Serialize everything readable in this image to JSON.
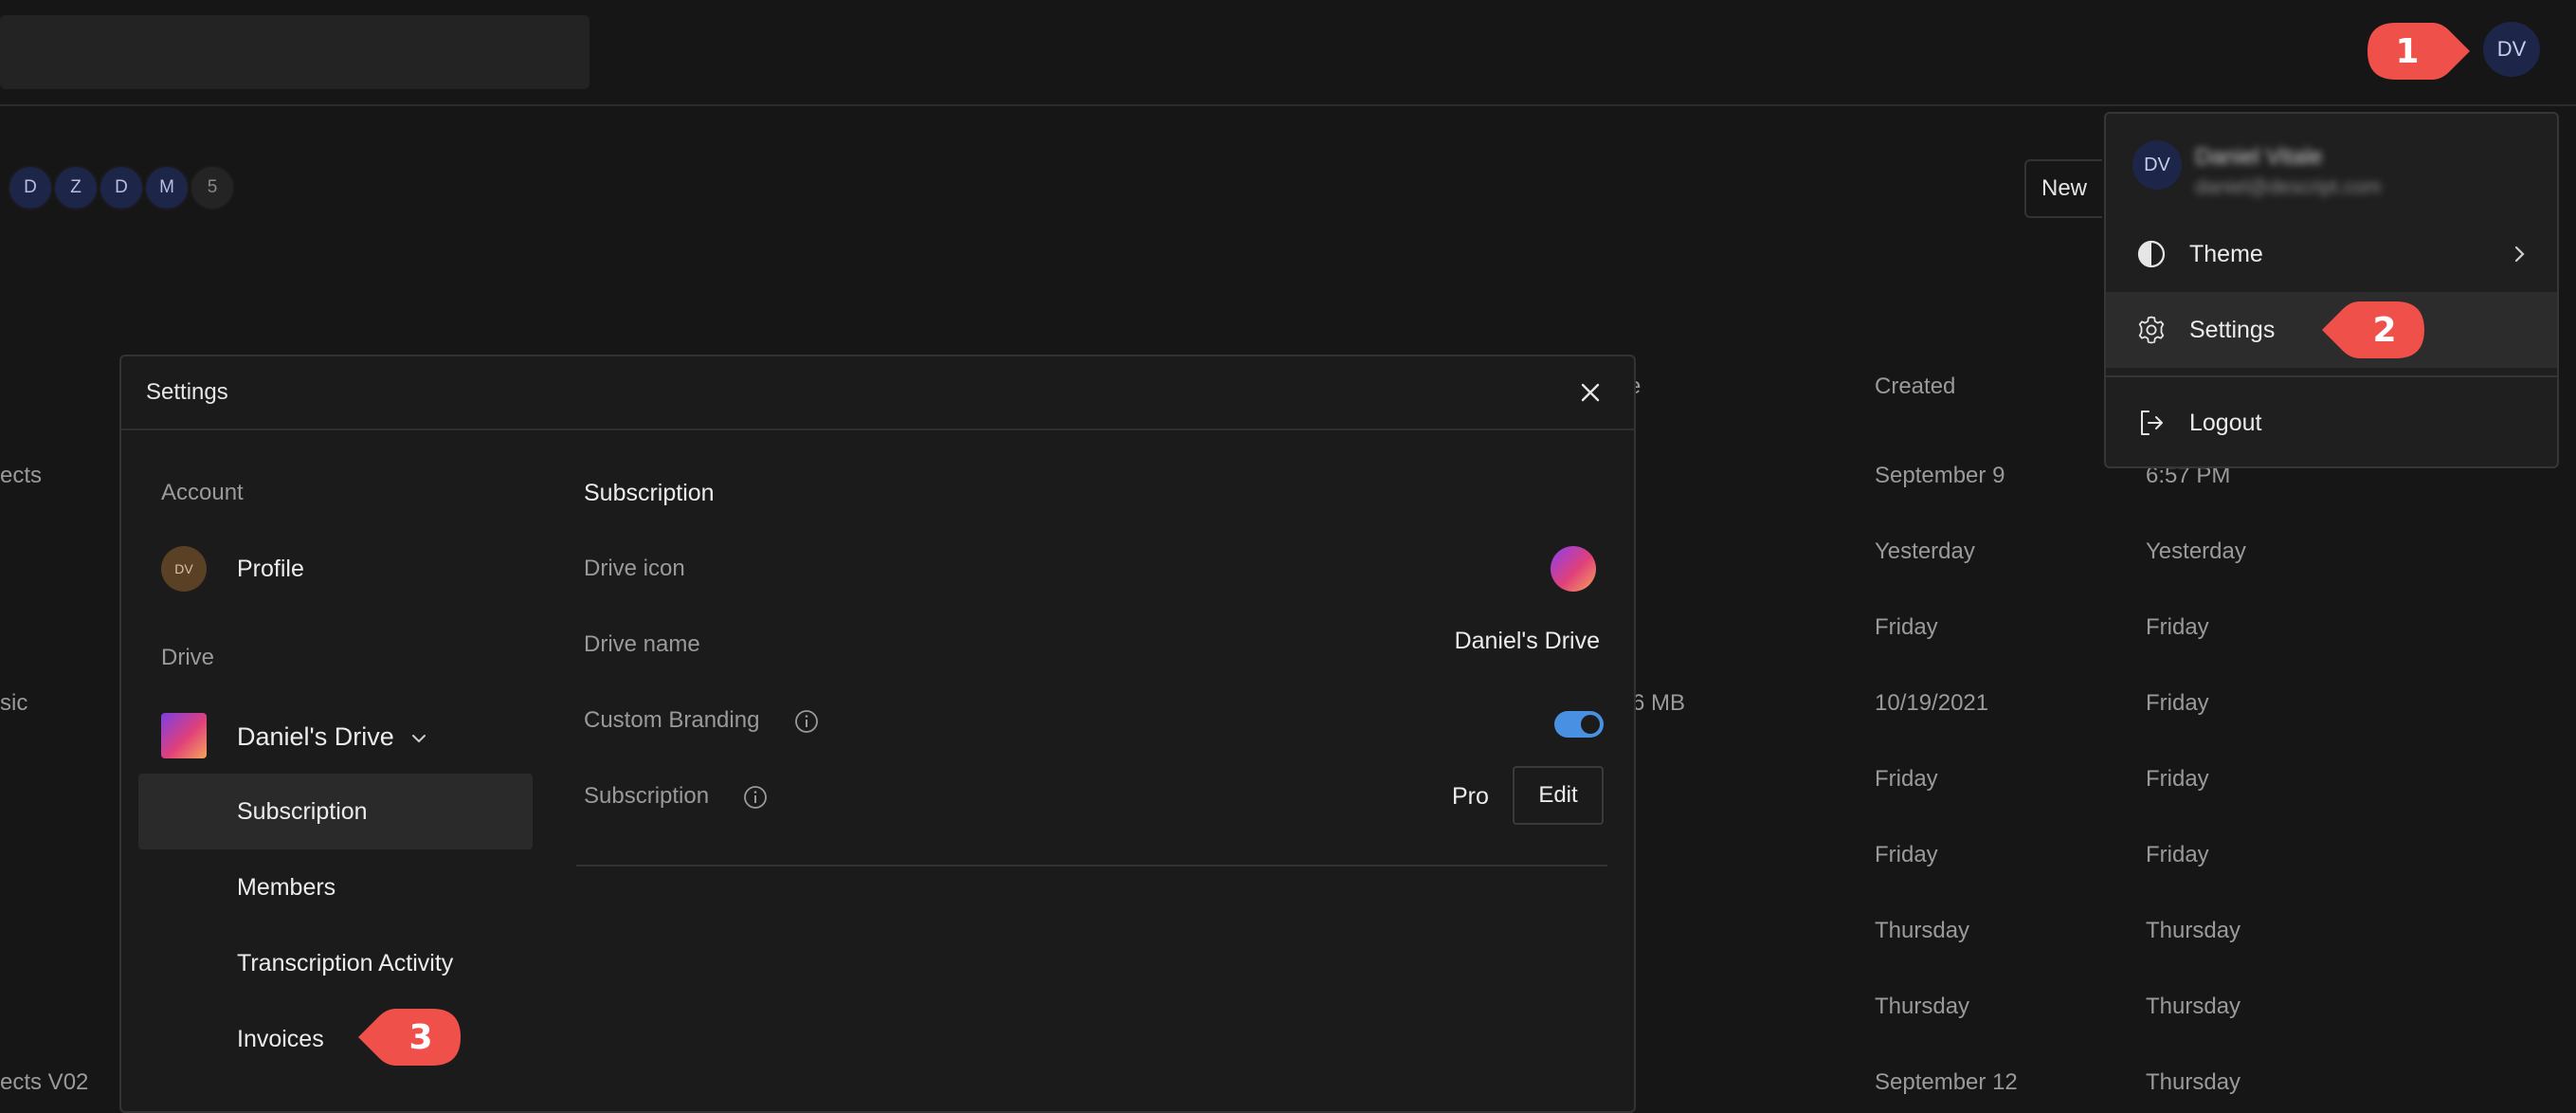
{
  "topbar": {
    "user_initials": "DV"
  },
  "members": [
    "D",
    "Z",
    "D",
    "M",
    "5"
  ],
  "new_button": "New",
  "background_table": {
    "headers": {
      "size_partial": "e",
      "created": "Created"
    },
    "rows": [
      {
        "name": "ects",
        "size": "",
        "created": "September 9",
        "modified": "6:57 PM"
      },
      {
        "name": "",
        "size": "",
        "created": "Yesterday",
        "modified": "Yesterday"
      },
      {
        "name": "",
        "size": "",
        "created": "Friday",
        "modified": "Friday"
      },
      {
        "name": "sic",
        "size": "6 MB",
        "created": "10/19/2021",
        "modified": "Friday"
      },
      {
        "name": "",
        "size": "",
        "created": "Friday",
        "modified": "Friday"
      },
      {
        "name": "",
        "size": "",
        "created": "Friday",
        "modified": "Friday"
      },
      {
        "name": "",
        "size": "",
        "created": "Thursday",
        "modified": "Thursday"
      },
      {
        "name": "",
        "size": "",
        "created": "Thursday",
        "modified": "Thursday"
      },
      {
        "name": "ects V02",
        "size": "",
        "created": "September 12",
        "modified": "Thursday"
      }
    ]
  },
  "settings_modal": {
    "title": "Settings",
    "sidebar": {
      "account_label": "Account",
      "profile_initials": "DV",
      "profile_label": "Profile",
      "drive_label": "Drive",
      "drive_name": "Daniel's Drive",
      "items": [
        "Subscription",
        "Members",
        "Transcription Activity",
        "Invoices"
      ]
    },
    "content": {
      "title": "Subscription",
      "drive_icon_label": "Drive icon",
      "drive_name_label": "Drive name",
      "drive_name_value": "Daniel's Drive",
      "custom_branding_label": "Custom Branding",
      "custom_branding_enabled": true,
      "subscription_label": "Subscription",
      "subscription_value": "Pro",
      "edit_label": "Edit"
    }
  },
  "user_menu": {
    "initials": "DV",
    "name": "Daniel Vitale",
    "email": "daniel@descript.com",
    "items": [
      "Theme",
      "Settings",
      "Logout"
    ]
  },
  "callouts": [
    "1",
    "2",
    "3"
  ],
  "colors": {
    "callout": "#f0504a",
    "accent": "#4a90e2",
    "avatar_bg": "#1d2548"
  }
}
